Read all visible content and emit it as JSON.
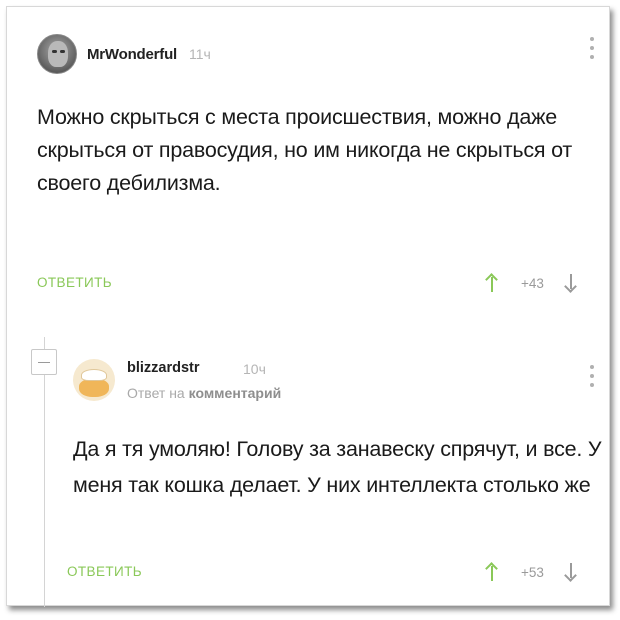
{
  "comment": {
    "author": "MrWonderful",
    "time": "11ч",
    "text": "Можно скрыться с места происшествия, можно даже скрыться от правосудия, но им никогда не скрыться от своего дебилизма.",
    "reply_label": "ОТВЕТИТЬ",
    "rating": "+43"
  },
  "reply": {
    "author": "blizzardstr",
    "time": "10ч",
    "reply_to_prefix": "Ответ на",
    "reply_to_link": "комментарий",
    "text": "Да я тя умоляю! Голову за занавеску спрячут, и все. У меня так кошка делает. У них интеллекта столько же",
    "reply_label": "ОТВЕТИТЬ",
    "rating": "+53"
  },
  "colors": {
    "accent_green": "#8ac858",
    "muted_gray": "#9a9a9a",
    "time_gray": "#b5b5b5"
  },
  "icons": {
    "menu": "vertical-dots-icon",
    "upvote": "arrow-up-icon",
    "downvote": "arrow-down-icon",
    "collapse": "minus-icon"
  }
}
